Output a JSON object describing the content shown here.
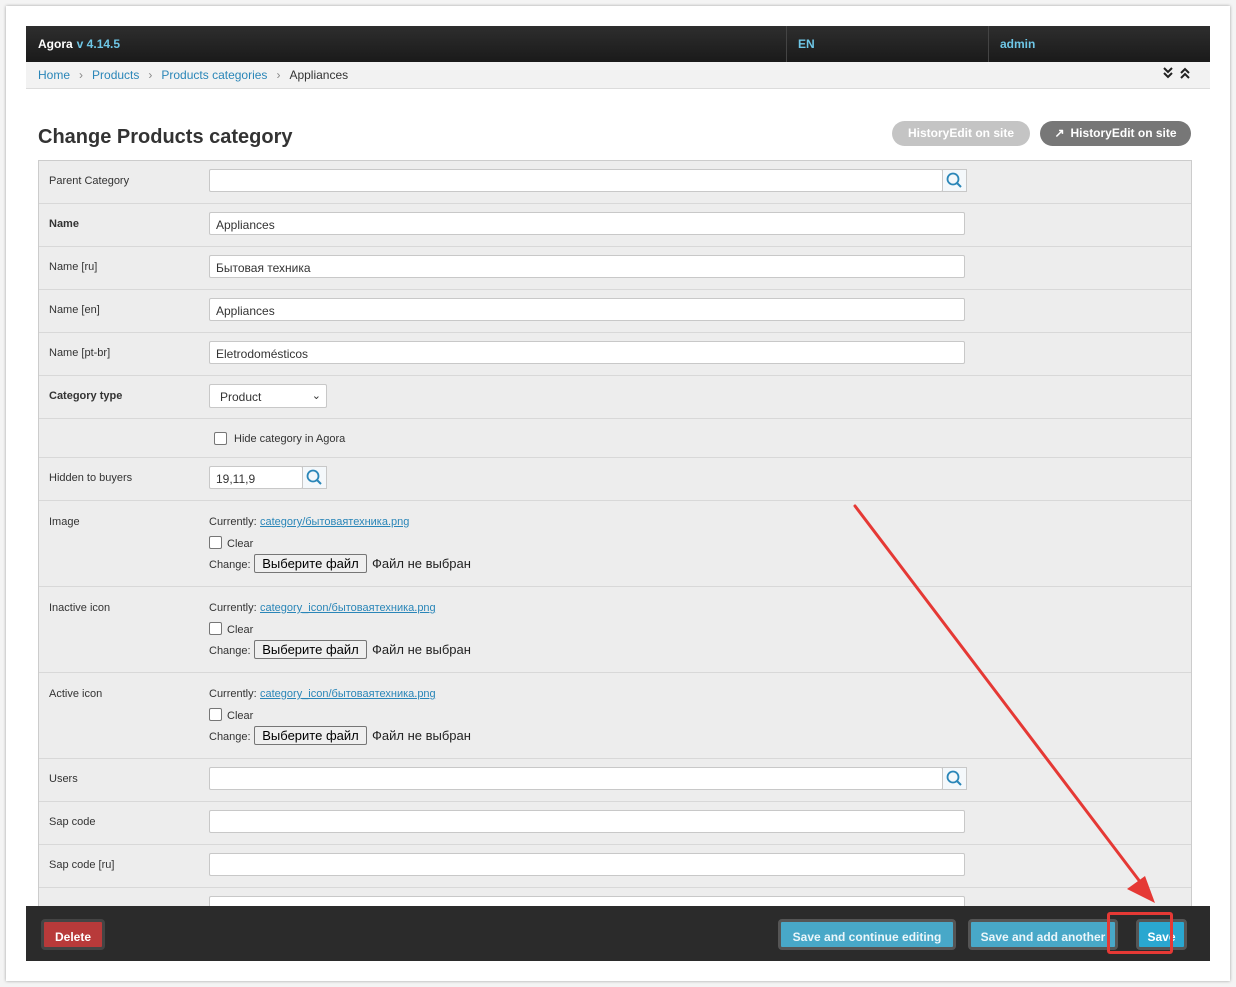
{
  "header": {
    "app_name": "Agora",
    "version": "v 4.14.5",
    "language": "EN",
    "user": "admin"
  },
  "breadcrumb": {
    "items": [
      "Home",
      "Products",
      "Products categories"
    ],
    "current": "Appliances",
    "toggle_icons": "⌄⌃"
  },
  "page": {
    "title": "Change Products category"
  },
  "object_tools": {
    "history": "HistoryEdit on site",
    "view_on_site": "HistoryEdit on site"
  },
  "fields": {
    "parent_category": {
      "label": "Parent Category",
      "value": ""
    },
    "name": {
      "label": "Name",
      "value": "Appliances"
    },
    "name_ru": {
      "label": "Name [ru]",
      "value": "Бытовая техника"
    },
    "name_en": {
      "label": "Name [en]",
      "value": "Appliances"
    },
    "name_ptbr": {
      "label": "Name [pt-br]",
      "value": "Eletrodomésticos"
    },
    "category_type": {
      "label": "Category type",
      "value": "Product"
    },
    "hide_category": {
      "label": "Hide category in Agora",
      "checked": false
    },
    "hidden_to_buyers": {
      "label": "Hidden to buyers",
      "value": "19,11,9"
    },
    "image": {
      "label": "Image",
      "currently_label": "Currently:",
      "current_file": "category/бытоваятехника.png",
      "clear_label": "Clear",
      "change_label": "Change:",
      "choose_button": "Выберите файл",
      "no_file": "Файл не выбран"
    },
    "inactive_icon": {
      "label": "Inactive icon",
      "currently_label": "Currently:",
      "current_file": "category_icon/бытоваятехника.png",
      "clear_label": "Clear",
      "change_label": "Change:",
      "choose_button": "Выберите файл",
      "no_file": "Файл не выбран"
    },
    "active_icon": {
      "label": "Active icon",
      "currently_label": "Currently:",
      "current_file": "category_icon/бытоваятехника.png",
      "clear_label": "Clear",
      "change_label": "Change:",
      "choose_button": "Выберите файл",
      "no_file": "Файл не выбран"
    },
    "users": {
      "label": "Users",
      "value": ""
    },
    "sap_code": {
      "label": "Sap code",
      "value": ""
    },
    "sap_code_ru": {
      "label": "Sap code [ru]",
      "value": ""
    }
  },
  "footer": {
    "delete": "Delete",
    "save_continue": "Save and continue editing",
    "save_add": "Save and add another",
    "save": "Save"
  },
  "colors": {
    "link": "#2a86b8",
    "primary": "#2aa7d0",
    "danger": "#b83a3a",
    "annotation": "#e53935"
  }
}
